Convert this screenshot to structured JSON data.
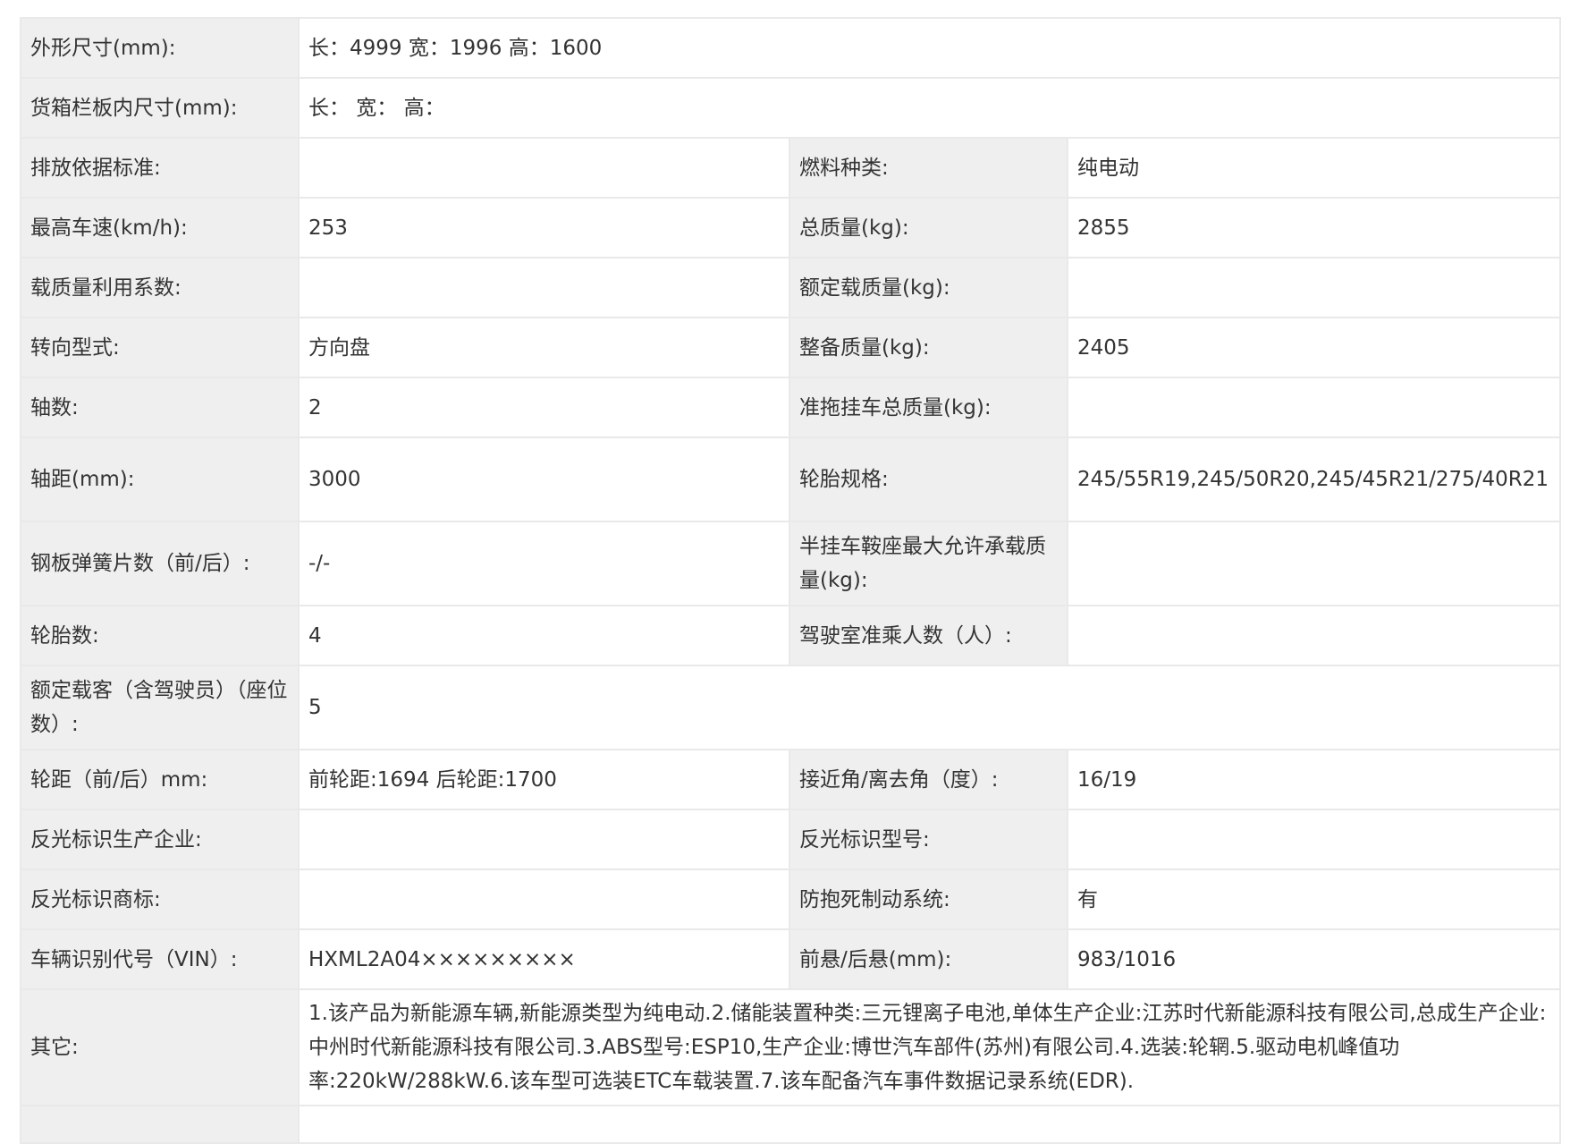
{
  "rows": [
    {
      "l1": "外形尺寸(mm):",
      "v1": "长：4999 宽：1996 高：1600"
    },
    {
      "l1": "货箱栏板内尺寸(mm):",
      "v1": "长：  宽：  高："
    },
    {
      "l1": "排放依据标准:",
      "v1": "",
      "l2": "燃料种类:",
      "v2": "纯电动"
    },
    {
      "l1": "最高车速(km/h):",
      "v1": "253",
      "l2": "总质量(kg):",
      "v2": "2855"
    },
    {
      "l1": "载质量利用系数:",
      "v1": "",
      "l2": "额定载质量(kg):",
      "v2": ""
    },
    {
      "l1": "转向型式:",
      "v1": "方向盘",
      "l2": "整备质量(kg):",
      "v2": "2405"
    },
    {
      "l1": "轴数:",
      "v1": "2",
      "l2": "准拖挂车总质量(kg):",
      "v2": ""
    },
    {
      "l1": "轴距(mm):",
      "v1": "3000",
      "l2": "轮胎规格:",
      "v2": "245/55R19,245/50R20,245/45R21/275/40R21"
    },
    {
      "l1": "钢板弹簧片数（前/后）:",
      "v1": "-/-",
      "l2": "半挂车鞍座最大允许承载质量(kg):",
      "v2": ""
    },
    {
      "l1": "轮胎数:",
      "v1": "4",
      "l2": "驾驶室准乘人数（人）:",
      "v2": ""
    },
    {
      "l1": "额定载客（含驾驶员）（座位数）:",
      "v1": "5"
    },
    {
      "l1": "轮距（前/后）mm:",
      "v1": "前轮距:1694 后轮距:1700",
      "l2": "接近角/离去角（度）:",
      "v2": "16/19"
    },
    {
      "l1": "反光标识生产企业:",
      "v1": "",
      "l2": "反光标识型号:",
      "v2": ""
    },
    {
      "l1": "反光标识商标:",
      "v1": "",
      "l2": "防抱死制动系统:",
      "v2": "有"
    },
    {
      "l1": "车辆识别代号（VIN）:",
      "v1": "HXML2A04×××××××××",
      "l2": "前悬/后悬(mm):",
      "v2": "983/1016"
    },
    {
      "l1": "其它:",
      "v1": "1.该产品为新能源车辆,新能源类型为纯电动.2.储能装置种类:三元锂离子电池,单体生产企业:江苏时代新能源科技有限公司,总成生产企业:中州时代新能源科技有限公司.3.ABS型号:ESP10,生产企业:博世汽车部件(苏州)有限公司.4.选装:轮辋.5.驱动电机峰值功率:220kW/288kW.6.该车型可选装ETC车载装置.7.该车配备汽车事件数据记录系统(EDR)."
    }
  ]
}
